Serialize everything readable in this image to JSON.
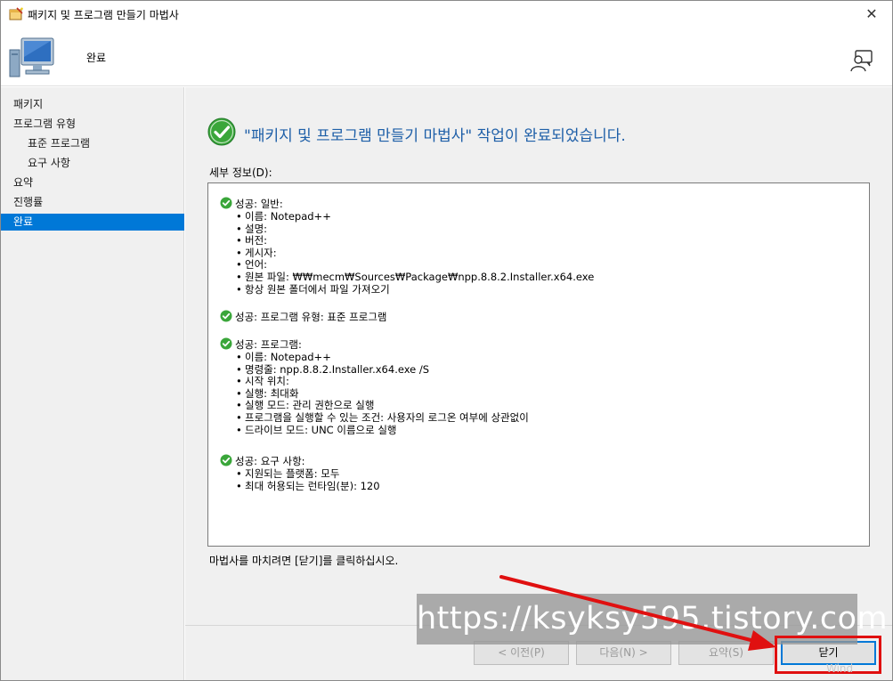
{
  "window": {
    "title": "패키지 및 프로그램 만들기 마법사",
    "close_glyph": "✕"
  },
  "header": {
    "title": "완료"
  },
  "sidebar": {
    "items": [
      {
        "label": "패키지",
        "level": 0,
        "active": false
      },
      {
        "label": "프로그램 유형",
        "level": 0,
        "active": false
      },
      {
        "label": "표준 프로그램",
        "level": 1,
        "active": false
      },
      {
        "label": "요구 사항",
        "level": 1,
        "active": false
      },
      {
        "label": "요약",
        "level": 0,
        "active": false
      },
      {
        "label": "진행률",
        "level": 0,
        "active": false
      },
      {
        "label": "완료",
        "level": 0,
        "active": true
      }
    ]
  },
  "main": {
    "title": "\"패키지 및 프로그램 만들기 마법사\" 작업이 완료되었습니다.",
    "details_label": "세부 정보(D):",
    "sections": [
      {
        "head": "성공: 일반:",
        "items": [
          "이름: Notepad++",
          "설명:",
          "버전:",
          "게시자:",
          "언어:",
          "원본 파일: ₩₩mecm₩Sources₩Package₩npp.8.8.2.Installer.x64.exe",
          "항상 원본 폴더에서 파일 가져오기"
        ]
      },
      {
        "head": "성공: 프로그램 유형: 표준 프로그램",
        "items": []
      },
      {
        "head": "성공: 프로그램:",
        "items": [
          "이름: Notepad++",
          "명령줄: npp.8.8.2.Installer.x64.exe /S",
          "시작 위치:",
          "실행: 최대화",
          "실행 모드: 관리 권한으로 실행",
          "프로그램을 실행할 수 있는 조건: 사용자의 로그온 여부에 상관없이",
          "드라이브 모드: UNC 이름으로 실행"
        ]
      },
      {
        "head": "성공: 요구 사항:",
        "items": [
          "지원되는 플랫폼: 모두",
          "최대 허용되는 런타임(분): 120"
        ]
      }
    ],
    "finish_note": "마법사를 마치려면 [닫기]를 클릭하십시오."
  },
  "buttons": {
    "prev": "< 이전(P)",
    "next": "다음(N) >",
    "summary": "요약(S)",
    "close": "닫기"
  },
  "overlay": {
    "watermark": "https://ksyksy595.tistory.com",
    "corner": "Wind"
  },
  "colors": {
    "accent": "#0078d7",
    "title_text": "#1e5fa8",
    "success_green": "#3aa63a",
    "annotation_red": "#e01010"
  }
}
